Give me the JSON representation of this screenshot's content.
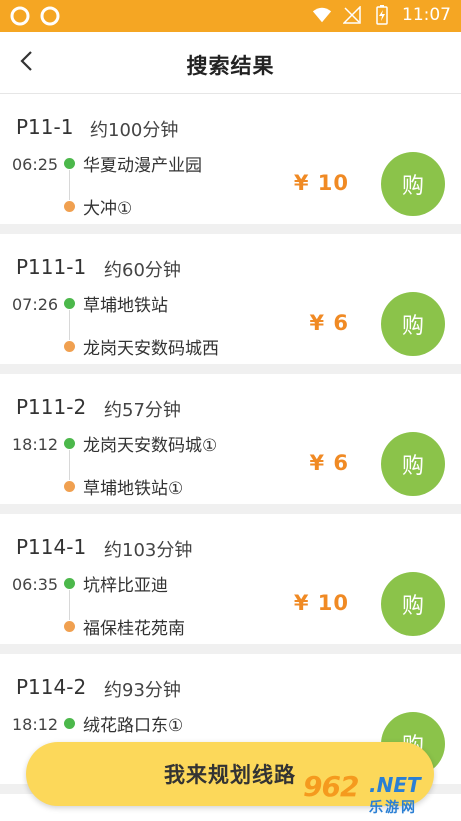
{
  "status_bar": {
    "time": "11:07",
    "icons": [
      "sync-icon",
      "sync-icon",
      "wifi-icon",
      "no-signal-icon",
      "battery-charging-icon"
    ],
    "bg_color": "#f5a623"
  },
  "header": {
    "title": "搜索结果",
    "back_icon": "chevron-left-icon"
  },
  "routes": [
    {
      "code": "P11-1",
      "duration": "约100分钟",
      "time": "06:25",
      "from": "华夏动漫产业园",
      "to": "大冲①",
      "price": "¥ 10",
      "buy": "购"
    },
    {
      "code": "P111-1",
      "duration": "约60分钟",
      "time": "07:26",
      "from": "草埔地铁站",
      "to": "龙岗天安数码城西",
      "price": "¥ 6",
      "buy": "购"
    },
    {
      "code": "P111-2",
      "duration": "约57分钟",
      "time": "18:12",
      "from": "龙岗天安数码城①",
      "to": "草埔地铁站①",
      "price": "¥ 6",
      "buy": "购"
    },
    {
      "code": "P114-1",
      "duration": "约103分钟",
      "time": "06:35",
      "from": "坑梓比亚迪",
      "to": "福保桂花苑南",
      "price": "¥ 10",
      "buy": "购"
    },
    {
      "code": "P114-2",
      "duration": "约93分钟",
      "time": "18:12",
      "from": "绒花路口东①",
      "to": "",
      "price": "",
      "buy": "购"
    }
  ],
  "plan_button": {
    "label": "我来规划线路"
  },
  "watermark": {
    "num": "962",
    "net": ".NET",
    "cn": "乐游网"
  },
  "colors": {
    "accent": "#f5a623",
    "price": "#f08a24",
    "buy": "#8bc34a",
    "plan": "#fcd85a",
    "from_dot": "#4cb84b",
    "to_dot": "#f0a050"
  }
}
